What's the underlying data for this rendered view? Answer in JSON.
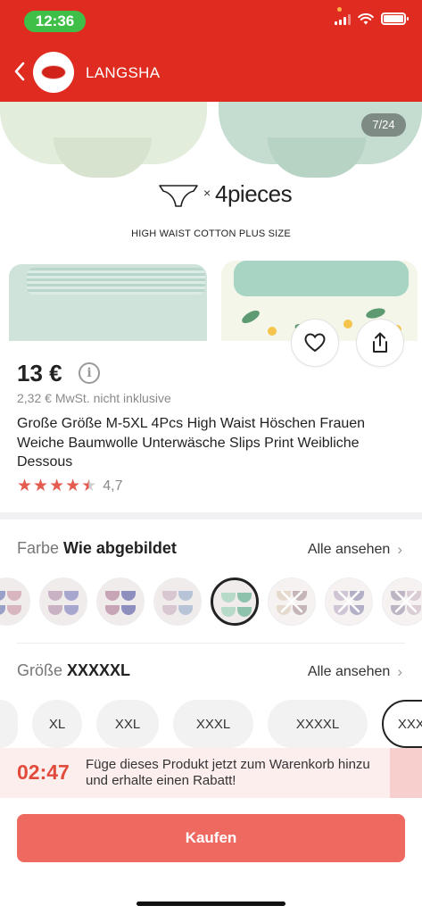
{
  "status_bar": {
    "time": "12:36"
  },
  "header": {
    "store_name": "LANGSHA"
  },
  "gallery": {
    "counter": "7/24",
    "multiplier": "×",
    "pieces_text": "4pieces",
    "caption": "HIGH WAIST COTTON  PLUS SIZE"
  },
  "product": {
    "price": "13 €",
    "tax_note": "2,32 € MwSt. nicht inklusive",
    "title": "Große Größe M-5XL 4Pcs High Waist Höschen Frauen Weiche Baumwolle Unterwäsche Slips Print Weibliche Dessous",
    "rating": 4.7,
    "rating_text": "4,7"
  },
  "color_section": {
    "label": "Farbe",
    "value": "Wie abgebildet",
    "see_all": "Alle ansehen",
    "swatches": [
      {
        "palette": [
          "#9aa0c8",
          "#d7b6c0"
        ],
        "selected": false,
        "unavailable": false
      },
      {
        "palette": [
          "#c9b2c4",
          "#a7a6cf"
        ],
        "selected": false,
        "unavailable": false
      },
      {
        "palette": [
          "#c7a4b6",
          "#8e8fbf"
        ],
        "selected": false,
        "unavailable": false
      },
      {
        "palette": [
          "#d8c6d0",
          "#b7c4d8"
        ],
        "selected": false,
        "unavailable": false
      },
      {
        "palette": [
          "#b8dac9",
          "#8fc2ad"
        ],
        "selected": true,
        "unavailable": false
      },
      {
        "palette": [
          "#d9c7b4",
          "#a78e94"
        ],
        "selected": false,
        "unavailable": true
      },
      {
        "palette": [
          "#b7a6bf",
          "#8b84a8"
        ],
        "selected": false,
        "unavailable": true
      },
      {
        "palette": [
          "#9a8ea4",
          "#c6b3bd"
        ],
        "selected": false,
        "unavailable": true
      },
      {
        "palette": [
          "#b28c96",
          "#8a7682"
        ],
        "selected": false,
        "unavailable": false
      }
    ]
  },
  "size_section": {
    "label": "Größe",
    "value": "XXXXXL",
    "see_all": "Alle ansehen",
    "options": [
      {
        "label": "",
        "selected": false
      },
      {
        "label": "XL",
        "selected": false
      },
      {
        "label": "XXL",
        "selected": false
      },
      {
        "label": "XXXL",
        "selected": false
      },
      {
        "label": "XXXXL",
        "selected": false
      },
      {
        "label": "XXXXXL",
        "selected": true
      }
    ]
  },
  "promo": {
    "timer": "02:47",
    "text": "Füge dieses Produkt jetzt zum Warenkorb hinzu und erhalte einen Rabatt!"
  },
  "actions": {
    "buy_label": "Kaufen"
  },
  "colors": {
    "brand_red": "#e02c20",
    "buy_button": "#ee6a61",
    "star": "#e45c50",
    "timer": "#e24b3b"
  }
}
